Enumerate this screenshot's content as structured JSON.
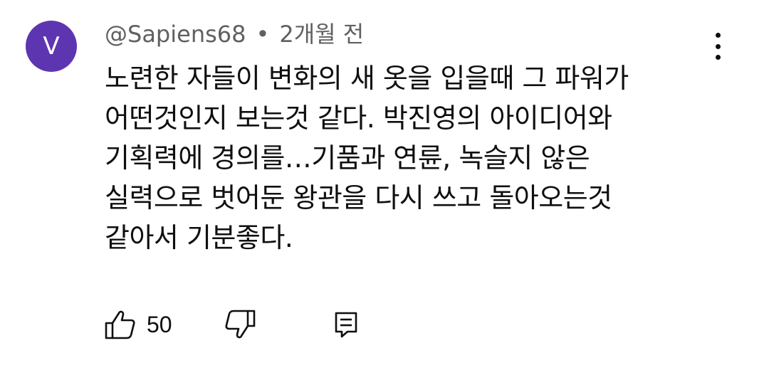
{
  "comment": {
    "avatar_letter": "V",
    "avatar_color": "#5e35b1",
    "author": "@Sapiens68",
    "separator": "•",
    "time": "2개월 전",
    "text": "노련한 자들이 변화의 새 옷을 입을때 그 파워가\n어떤것인지 보는것 같다. 박진영의 아이디어와\n기획력에 경의를…기품과 연륜, 녹슬지 않은\n실력으로 벗어둔 왕관을 다시 쓰고 돌아오는것\n같아서 기분좋다.",
    "like_count": "50"
  },
  "icons": {
    "like": "thumbs-up-icon",
    "dislike": "thumbs-down-icon",
    "reply": "reply-comment-icon",
    "menu": "more-vert-icon"
  }
}
